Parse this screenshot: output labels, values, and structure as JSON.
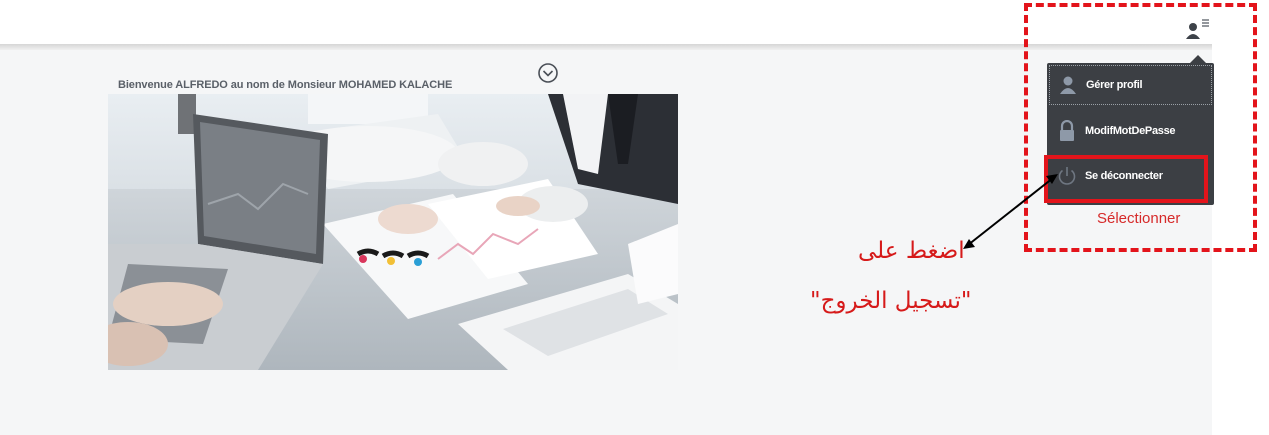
{
  "header": {
    "welcome_text": "Bienvenue ALFREDO au nom de Monsieur MOHAMED KALACHE",
    "collapse_icon": "chevron-down-circle-icon",
    "user_menu_icon": "user-menu-icon"
  },
  "user_menu": {
    "items": [
      {
        "label": "Gérer profil",
        "icon": "user-icon"
      },
      {
        "label": "ModifMotDePasse",
        "icon": "lock-icon"
      },
      {
        "label": "Se déconnecter",
        "icon": "power-icon"
      }
    ]
  },
  "annotation": {
    "select_label": "Sélectionner",
    "instruction_line1": "اضغط على",
    "instruction_line2": "\"تسجيل الخروج\""
  },
  "colors": {
    "menu_bg": "#3c3f44",
    "annotation_red": "#e3141b",
    "welcome_text": "#5a6068"
  }
}
